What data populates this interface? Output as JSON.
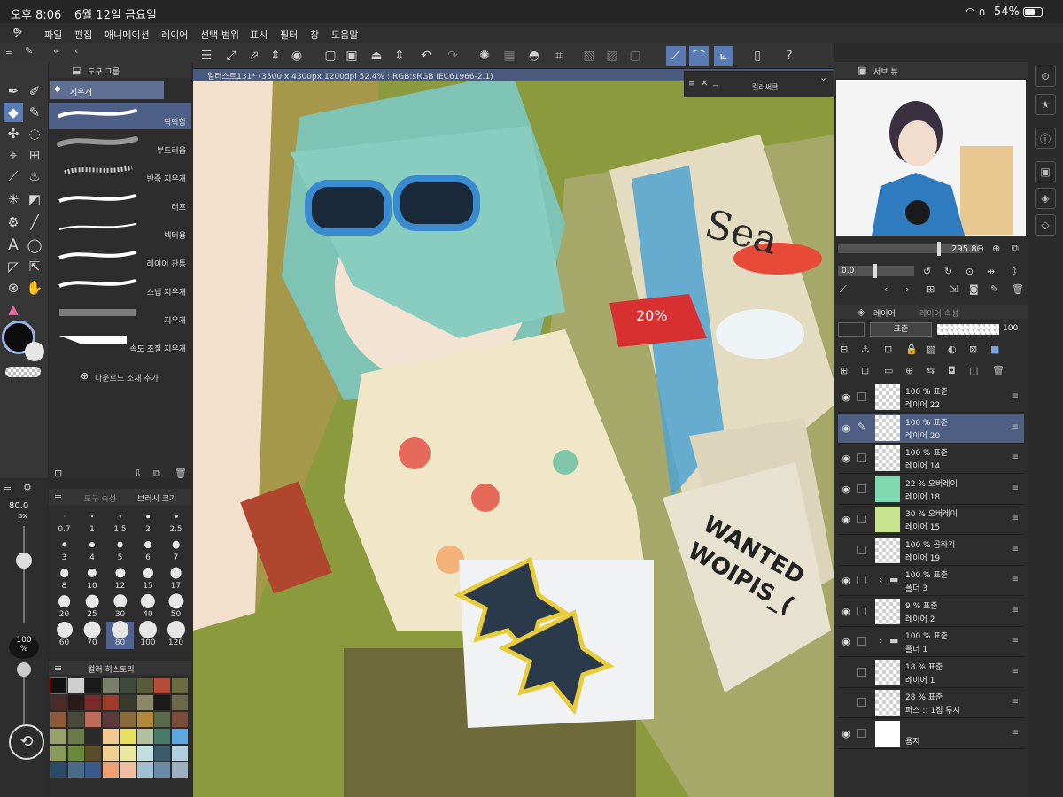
{
  "status_bar": {
    "time": "오후 8:06",
    "date": "6월 12일 금요일",
    "battery": "54%"
  },
  "menu": [
    "파일",
    "편집",
    "애니메이션",
    "레이어",
    "선택 범위",
    "표시",
    "필터",
    "창",
    "도움말"
  ],
  "subtool_panel": {
    "tab": "도구 그룹",
    "group": "지우개",
    "brushes": [
      "딱딱함",
      "부드러움",
      "반죽 지우개",
      "러프",
      "벡터용",
      "레이어 관통",
      "스냅 지우개",
      "지우개",
      "속도 조절 지우개"
    ],
    "add_material": "다운로드 소재 추가"
  },
  "brush_panel": {
    "tabs": [
      "도구 속성",
      "브러시 크기"
    ],
    "size_value": "80.0",
    "size_unit": "px",
    "opacity_value": "100",
    "opacity_unit": "%",
    "sizes": [
      "0.7",
      "1",
      "1.5",
      "2",
      "2.5",
      "3",
      "4",
      "5",
      "6",
      "7",
      "8",
      "10",
      "12",
      "15",
      "17",
      "20",
      "25",
      "30",
      "40",
      "50",
      "60",
      "70",
      "80",
      "100",
      "120"
    ],
    "selected_size": "80"
  },
  "color_history": {
    "tabs": [
      "컬러 히스토리"
    ],
    "swatches": [
      "#111111",
      "#cfcfcf",
      "#1a1a1a",
      "#7a7f6a",
      "#3b4a3a",
      "#5a5a3a",
      "#b84a3a",
      "#6a6b3f",
      "#4a2a2a",
      "#2a1a1a",
      "#7a2a2a",
      "#a03a2a",
      "#3a3a2a",
      "#8a8a6a",
      "#1a1a1a",
      "#6a6a4a",
      "#8a5a3a",
      "#4a4a3a",
      "#c06a5a",
      "#5a3a3a",
      "#8a6a3a",
      "#b08a3a",
      "#5a6a4a",
      "#7a4a3a",
      "#9aa06a",
      "#6a7a4a",
      "#2a2a2a",
      "#f0c890",
      "#e8e060",
      "#b0c0a0",
      "#4a7a6a",
      "#5aaae0",
      "#8a9a5a",
      "#6a8a3a",
      "#5a4a2a",
      "#f0d090",
      "#e8e8a0",
      "#c0e0e0",
      "#3a5a6a",
      "#b0d0e0",
      "#2a4a6a",
      "#4a6a8a",
      "#3a5a8a",
      "#f0a070",
      "#f0c0a0",
      "#a0c0d0",
      "#6a8aaa",
      "#9ab0c0"
    ]
  },
  "canvas": {
    "title": "일러스트131* (3500 x 4300px 1200dpi 52.4% : RGB:sRGB IEC61966-2.1)"
  },
  "color_circle_panel": {
    "title": "컬러써클"
  },
  "sub_view": {
    "title": "서브 뷰",
    "zoom": "295.8",
    "rotation": "0.0"
  },
  "layer_panel": {
    "tabs": [
      "레이어",
      "레이어 속성"
    ],
    "blend_mode": "표준",
    "opacity": "100",
    "layers": [
      {
        "line1": "100 % 표준",
        "line2": "레이어 22",
        "visible": true,
        "selected": false,
        "folder": false
      },
      {
        "line1": "100 % 표준",
        "line2": "레이어 20",
        "visible": true,
        "selected": true,
        "folder": false
      },
      {
        "line1": "100 % 표준",
        "line2": "레이어 14",
        "visible": true,
        "selected": false,
        "folder": false
      },
      {
        "line1": "22 % 오버레이",
        "line2": "레이어 18",
        "visible": true,
        "selected": false,
        "folder": false,
        "fill": "#7ed9b0"
      },
      {
        "line1": "30 % 오버레이",
        "line2": "레이어 15",
        "visible": true,
        "selected": false,
        "folder": false,
        "fill": "#c6e58e"
      },
      {
        "line1": "100 % 곱하기",
        "line2": "레이어 19",
        "visible": false,
        "selected": false,
        "folder": false
      },
      {
        "line1": "100 % 표준",
        "line2": "폴더 3",
        "visible": true,
        "selected": false,
        "folder": true
      },
      {
        "line1": "9 % 표준",
        "line2": "레이어 2",
        "visible": true,
        "selected": false,
        "folder": false
      },
      {
        "line1": "100 % 표준",
        "line2": "폴더 1",
        "visible": true,
        "selected": false,
        "folder": true
      },
      {
        "line1": "18 % 표준",
        "line2": "레이어 1",
        "visible": false,
        "selected": false,
        "folder": false
      },
      {
        "line1": "28 % 표준",
        "line2": "퍼스 :: 1점 투시",
        "visible": false,
        "selected": false,
        "folder": false
      },
      {
        "line1": "",
        "line2": "용지",
        "visible": true,
        "selected": false,
        "folder": false,
        "fill": "#ffffff"
      }
    ]
  },
  "artwork_text": {
    "sea": "Sea",
    "sale": "20%",
    "wanted_1": "WANTED",
    "wanted_2": "WOIPIS_("
  }
}
